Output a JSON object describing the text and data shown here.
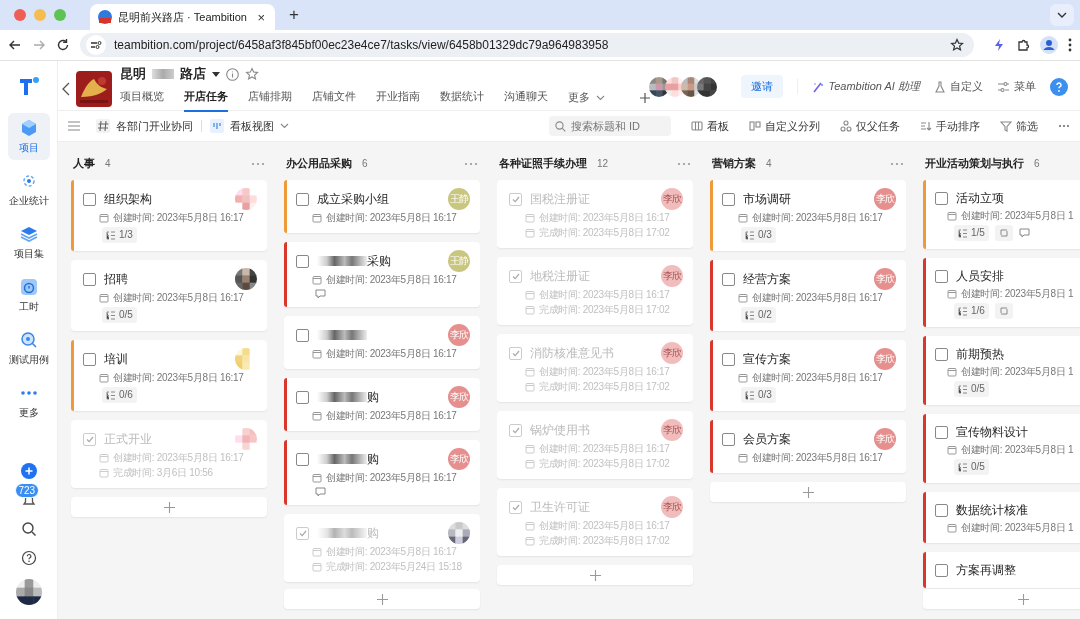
{
  "browser": {
    "tab": {
      "title": "昆明前兴路店 · Teambition",
      "close": "×"
    },
    "new_tab": "+",
    "address": "teambition.com/project/6458af3f845bf00ec23e4ce7/tasks/view/6458b01329dc79a964983958"
  },
  "sidebar": {
    "items": [
      {
        "label": "项目",
        "selected": true
      },
      {
        "label": "企业统计",
        "selected": false
      },
      {
        "label": "项目集",
        "selected": false
      },
      {
        "label": "工时",
        "selected": false
      },
      {
        "label": "测试用例",
        "selected": false
      },
      {
        "label": "更多",
        "selected": false
      }
    ],
    "badge": "723"
  },
  "project": {
    "title_start": "昆明",
    "title_end": "路店",
    "tabs": [
      {
        "label": "项目概览",
        "selected": false
      },
      {
        "label": "开店任务",
        "selected": true
      },
      {
        "label": "店铺排期",
        "selected": false
      },
      {
        "label": "店铺文件",
        "selected": false
      },
      {
        "label": "开业指南",
        "selected": false
      },
      {
        "label": "数据统计",
        "selected": false
      },
      {
        "label": "沟通聊天",
        "selected": false
      }
    ],
    "more": "更多",
    "invite": "邀请",
    "ai": "Teambition AI 助理",
    "customize": "自定义",
    "menu": "菜单"
  },
  "toolbar": {
    "group": "各部门开业协同",
    "view": "看板视图",
    "search": {
      "placeholder": "搜索标题和 ID"
    },
    "actions": [
      "看板",
      "自定义分列",
      "仅父任务",
      "手动排序",
      "筛选"
    ]
  },
  "columns": [
    {
      "name": "人事",
      "count": "4",
      "cards": [
        {
          "title": "组织架构",
          "redacted": false,
          "done": false,
          "color": "#ef9a3a",
          "created": "创建时间: 2023年5月8日 16:17",
          "subtasks": "1/3",
          "repeat": false,
          "comment": false
        },
        {
          "title": "招聘",
          "redacted": false,
          "done": false,
          "created": "创建时间: 2023年5月8日 16:17",
          "subtasks": "0/5",
          "repeat": false,
          "comment": false
        },
        {
          "title": "培训",
          "redacted": false,
          "done": false,
          "color": "#ef9a3a",
          "created": "创建时间: 2023年5月8日 16:17",
          "subtasks": "0/6",
          "repeat": false,
          "comment": false
        },
        {
          "title": "正式开业",
          "redacted": false,
          "done": true,
          "created": "创建时间: 2023年5月8日 16:17",
          "completed": "完成时间: 3月6日 10:56",
          "repeat": false,
          "comment": false
        }
      ]
    },
    {
      "name": "办公用品采购",
      "count": "6",
      "cards": [
        {
          "title": "成立采购小组",
          "redacted": false,
          "done": false,
          "color": "#ef9a3a",
          "avatar": {
            "kind": "text",
            "label": "王静",
            "color": "#c9c77f"
          },
          "created": "创建时间: 2023年5月8日 16:17",
          "repeat": false,
          "comment": false
        },
        {
          "title": "采购",
          "redacted": true,
          "done": false,
          "color": "#d9372b",
          "avatar": {
            "kind": "text",
            "label": "王静",
            "color": "#c9c77f"
          },
          "created": "创建时间: 2023年5月8日 16:17",
          "repeat": false,
          "comment": true
        },
        {
          "redacted": true,
          "done": false,
          "avatar": {
            "kind": "text",
            "label": "李欣",
            "color": "#e5908e"
          },
          "created": "创建时间: 2023年5月8日 16:17",
          "repeat": false,
          "comment": false
        },
        {
          "title": "购",
          "redacted": true,
          "done": false,
          "color": "#d9372b",
          "avatar": {
            "kind": "text",
            "label": "李欣",
            "color": "#e5908e"
          },
          "created": "创建时间: 2023年5月8日 16:17",
          "repeat": false,
          "comment": false
        },
        {
          "title": "购",
          "redacted": true,
          "done": false,
          "color": "#d9372b",
          "avatar": {
            "kind": "text",
            "label": "李欣",
            "color": "#e5908e"
          },
          "created": "创建时间: 2023年5月8日 16:17",
          "repeat": false,
          "comment": true
        },
        {
          "title": "购",
          "redacted": true,
          "done": true,
          "created": "创建时间: 2023年5月8日 16:17",
          "completed": "完成时间: 2023年5月24日 15:18",
          "repeat": false,
          "comment": false
        }
      ]
    },
    {
      "name": "各种证照手续办理",
      "count": "12",
      "cards": [
        {
          "title": "国税注册证",
          "redacted": false,
          "done": true,
          "avatar": {
            "kind": "text",
            "label": "李欣",
            "color": "#f1bdbc"
          },
          "created": "创建时间: 2023年5月8日 16:17",
          "completed": "完成时间: 2023年5月8日 17:02",
          "repeat": false,
          "comment": false
        },
        {
          "title": "地税注册证",
          "redacted": false,
          "done": true,
          "avatar": {
            "kind": "text",
            "label": "李欣",
            "color": "#f1bdbc"
          },
          "created": "创建时间: 2023年5月8日 16:17",
          "completed": "完成时间: 2023年5月8日 17:02",
          "repeat": false,
          "comment": false
        },
        {
          "title": "消防核准意见书",
          "redacted": false,
          "done": true,
          "avatar": {
            "kind": "text",
            "label": "李欣",
            "color": "#f1bdbc"
          },
          "created": "创建时间: 2023年5月8日 16:17",
          "completed": "完成时间: 2023年5月8日 17:02",
          "repeat": false,
          "comment": false
        },
        {
          "title": "锅炉使用书",
          "redacted": false,
          "done": true,
          "avatar": {
            "kind": "text",
            "label": "李欣",
            "color": "#f1bdbc"
          },
          "created": "创建时间: 2023年5月8日 16:17",
          "completed": "完成时间: 2023年5月8日 17:02",
          "repeat": false,
          "comment": false
        },
        {
          "title": "卫生许可证",
          "redacted": false,
          "done": true,
          "avatar": {
            "kind": "text",
            "label": "李欣",
            "color": "#f1bdbc"
          },
          "created": "创建时间: 2023年5月8日 16:17",
          "completed": "完成时间: 2023年5月8日 17:02",
          "repeat": false,
          "comment": false
        }
      ]
    },
    {
      "name": "营销方案",
      "count": "4",
      "cards": [
        {
          "title": "市场调研",
          "redacted": false,
          "done": false,
          "color": "#ef9a3a",
          "avatar": {
            "kind": "text",
            "label": "李欣",
            "color": "#e5908e"
          },
          "created": "创建时间: 2023年5月8日 16:17",
          "subtasks": "0/3",
          "repeat": false,
          "comment": false
        },
        {
          "title": "经营方案",
          "redacted": false,
          "done": false,
          "color": "#d9372b",
          "avatar": {
            "kind": "text",
            "label": "李欣",
            "color": "#e5908e"
          },
          "created": "创建时间: 2023年5月8日 16:17",
          "subtasks": "0/2",
          "repeat": false,
          "comment": false
        },
        {
          "title": "宣传方案",
          "redacted": false,
          "done": false,
          "color": "#d9372b",
          "avatar": {
            "kind": "text",
            "label": "李欣",
            "color": "#e5908e"
          },
          "created": "创建时间: 2023年5月8日 16:17",
          "subtasks": "0/3",
          "repeat": false,
          "comment": false
        },
        {
          "title": "会员方案",
          "redacted": false,
          "done": false,
          "color": "#d9372b",
          "avatar": {
            "kind": "text",
            "label": "李欣",
            "color": "#e5908e"
          },
          "created": "创建时间: 2023年5月8日 16:17",
          "repeat": false,
          "comment": false
        }
      ]
    },
    {
      "name": "开业活动策划与执行",
      "count": "6",
      "cards": [
        {
          "title": "活动立项",
          "redacted": false,
          "done": false,
          "color": "#ef9a3a",
          "created": "创建时间: 2023年5月8日 1",
          "subtasks": "1/5",
          "repeat": true,
          "comment": true
        },
        {
          "title": "人员安排",
          "redacted": false,
          "done": false,
          "color": "#d9372b",
          "created": "创建时间: 2023年5月8日 1",
          "subtasks": "1/6",
          "repeat": true,
          "comment": false
        },
        {
          "title": "前期预热",
          "redacted": false,
          "done": false,
          "color": "#d9372b",
          "created": "创建时间: 2023年5月8日 1",
          "subtasks": "0/5",
          "repeat": false,
          "comment": false
        },
        {
          "title": "宣传物料设计",
          "redacted": false,
          "done": false,
          "color": "#d9372b",
          "created": "创建时间: 2023年5月8日 1",
          "subtasks": "0/5",
          "repeat": false,
          "comment": false
        },
        {
          "title": "数据统计核准",
          "redacted": false,
          "done": false,
          "color": "#d9372b",
          "created": "创建时间: 2023年5月8日 1",
          "repeat": false,
          "comment": false
        },
        {
          "title": "方案再调整",
          "redacted": false,
          "done": false,
          "color": "#d9372b",
          "repeat": false,
          "comment": false
        }
      ]
    }
  ]
}
